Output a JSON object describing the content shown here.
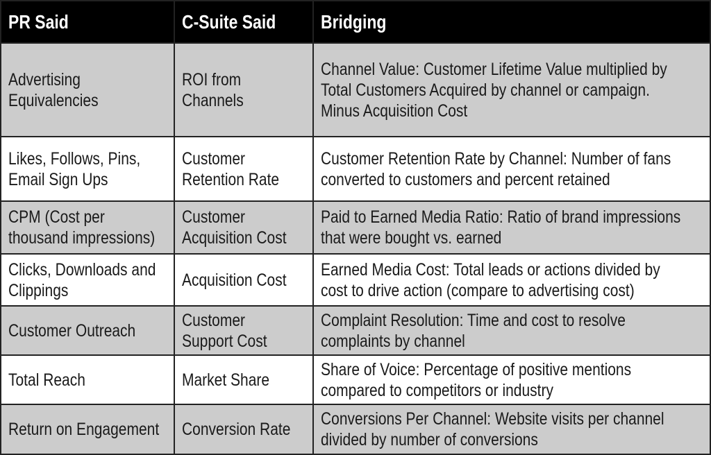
{
  "headers": [
    "PR Said",
    "C-Suite Said",
    "Bridging"
  ],
  "rows": [
    {
      "shade": "gray",
      "cells": [
        [
          "Advertising",
          "Equivalencies"
        ],
        [
          "ROI from",
          "Channels"
        ],
        [
          "Channel Value: Customer Lifetime Value multiplied by",
          "Total Customers Acquired by channel or campaign.",
          "Minus Acquisition Cost"
        ]
      ]
    },
    {
      "shade": "white",
      "cells": [
        [
          "Likes, Follows, Pins,",
          "Email Sign Ups"
        ],
        [
          "Customer",
          "Retention Rate"
        ],
        [
          "Customer Retention Rate by Channel: Number of fans",
          "converted to customers and percent retained"
        ]
      ]
    },
    {
      "shade": "gray",
      "cells": [
        [
          "CPM (Cost per",
          "thousand impressions)"
        ],
        [
          "Customer",
          "Acquisition Cost"
        ],
        [
          "Paid to Earned Media Ratio: Ratio of brand impressions",
          "that were bought vs. earned"
        ]
      ]
    },
    {
      "shade": "white",
      "cells": [
        [
          "Clicks, Downloads and",
          "Clippings"
        ],
        [
          "Acquisition Cost"
        ],
        [
          "Earned Media Cost: Total leads or actions divided by",
          "cost to drive action (compare to advertising cost)"
        ]
      ]
    },
    {
      "shade": "gray",
      "cells": [
        [
          "Customer Outreach"
        ],
        [
          "Customer",
          "Support Cost"
        ],
        [
          "Complaint Resolution: Time and cost to resolve",
          "complaints by channel"
        ]
      ]
    },
    {
      "shade": "white",
      "cells": [
        [
          "Total Reach"
        ],
        [
          "Market Share"
        ],
        [
          "Share of Voice: Percentage of positive mentions",
          "compared to competitors or industry"
        ]
      ]
    },
    {
      "shade": "gray",
      "cells": [
        [
          "Return on Engagement"
        ],
        [
          "Conversion Rate"
        ],
        [
          "Conversions Per Channel: Website visits per channel",
          "divided by number of conversions"
        ]
      ]
    }
  ],
  "colors": {
    "header_bg": "#000000",
    "gray_row": "#cccccc",
    "white_row": "#ffffff"
  }
}
